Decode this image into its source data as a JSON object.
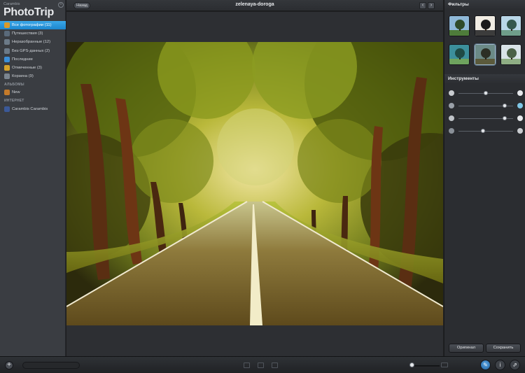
{
  "app": {
    "brand_small": "Carambis",
    "brand_name": "PhotoTrip",
    "brand_close_glyph": "×"
  },
  "sidebar": {
    "items": [
      {
        "label": "Все фотографии (11)",
        "icon": "photos-icon",
        "color": "#d99a2b",
        "active": true
      },
      {
        "label": "Путешествия (3)",
        "icon": "suitcase-icon",
        "color": "#5a6a7a"
      },
      {
        "label": "Неразобранные (12)",
        "icon": "stack-icon",
        "color": "#6c7a88"
      },
      {
        "label": "Без GPS-данных (2)",
        "icon": "no-gps-icon",
        "color": "#6c7a88"
      },
      {
        "label": "Последние",
        "icon": "clock-icon",
        "color": "#3b8fd9"
      },
      {
        "label": "Отмеченные (3)",
        "icon": "flag-icon",
        "color": "#d6a32a"
      },
      {
        "label": "Корзина (9)",
        "icon": "trash-icon",
        "color": "#7b8590"
      }
    ],
    "albums_title": "АЛЬБОМЫ",
    "albums": [
      {
        "label": "New",
        "icon": "album-icon",
        "color": "#c47a2a"
      }
    ],
    "internet_title": "ИНТЕРНЕТ",
    "internet": [
      {
        "label": "Carambis Carambis",
        "icon": "facebook-icon",
        "color": "#3b5998"
      }
    ]
  },
  "topbar": {
    "back_label": "Назад",
    "title": "zelenaya-doroga",
    "prev_glyph": "‹",
    "next_glyph": "›"
  },
  "panel": {
    "filters_title": "Фильтры",
    "filters": [
      {
        "name": "filter-original",
        "sky": "#8fb8d8",
        "ground": "#4e7c3a",
        "tree": "#2f4a2a"
      },
      {
        "name": "filter-bw",
        "sky": "#f1ede4",
        "ground": "#3c3c3c",
        "tree": "#1b1b1b"
      },
      {
        "name": "filter-cool",
        "sky": "#b9d7e8",
        "ground": "#6f9e8a",
        "tree": "#35584d"
      },
      {
        "name": "filter-teal",
        "sky": "#3c8f9b",
        "ground": "#6ea35e",
        "tree": "#1f4a44"
      },
      {
        "name": "filter-vintage",
        "sky": "#6b8a87",
        "ground": "#5b5a3c",
        "tree": "#2c2f25",
        "selected": true
      },
      {
        "name": "filter-faded",
        "sky": "#d9e3e8",
        "ground": "#8fae84",
        "tree": "#4b6147"
      }
    ],
    "tools_title": "Инструменты",
    "sliders": [
      {
        "name": "brightness",
        "value": 0.5
      },
      {
        "name": "saturation",
        "value": 0.85
      },
      {
        "name": "contrast",
        "value": 0.85
      },
      {
        "name": "sharpness",
        "value": 0.45
      }
    ],
    "original_label": "Оригинал",
    "save_label": "Сохранить"
  },
  "bottombar": {
    "add_glyph": "+",
    "zoom": 0.05,
    "edit_glyph": "✎",
    "info_glyph": "i",
    "share_glyph": "⇗"
  }
}
